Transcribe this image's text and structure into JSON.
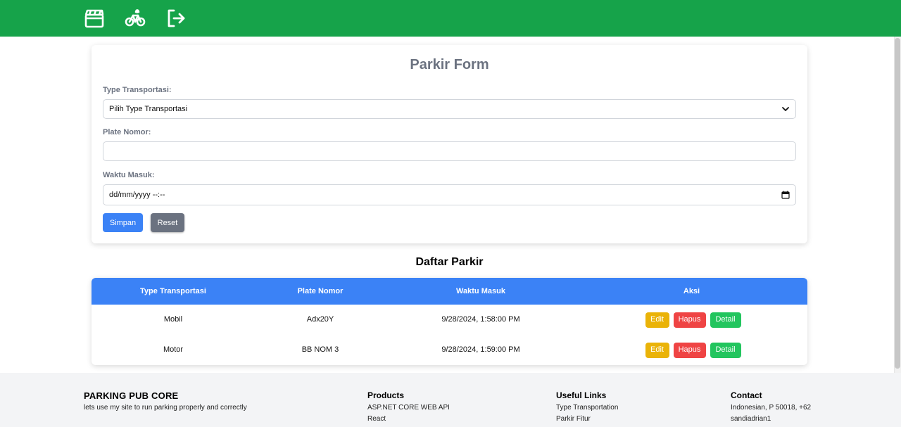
{
  "nav": {
    "icons": [
      "clapperboard-icon",
      "bicycle-icon",
      "logout-icon"
    ]
  },
  "form": {
    "title": "Parkir Form",
    "type_label": "Type Transportasi:",
    "type_selected": "Pilih Type Transportasi",
    "plate_label": "Plate Nomor:",
    "plate_value": "",
    "time_label": "Waktu Masuk:",
    "time_placeholder": "dd/mm/yyyy --:--",
    "save_label": "Simpan",
    "reset_label": "Reset"
  },
  "list": {
    "title": "Daftar Parkir",
    "columns": [
      "Type Transportasi",
      "Plate Nomor",
      "Waktu Masuk",
      "Aksi"
    ],
    "rows": [
      {
        "type": "Mobil",
        "plate": "Adx20Y",
        "time": "9/28/2024, 1:58:00 PM"
      },
      {
        "type": "Motor",
        "plate": "BB NOM 3",
        "time": "9/28/2024, 1:59:00 PM"
      }
    ],
    "actions": {
      "edit": "Edit",
      "hapus": "Hapus",
      "detail": "Detail"
    }
  },
  "footer": {
    "brand": "PARKING PUB CORE",
    "tagline": "lets use my site to run parking properly and correctly",
    "products_title": "Products",
    "products": [
      "ASP.NET CORE WEB API",
      "React"
    ],
    "links_title": "Useful Links",
    "links": [
      "Type Transportation",
      "Parkir Fitur"
    ],
    "contact_title": "Contact",
    "contact": [
      "Indonesian, P 50018, +62",
      "sandiadrian1"
    ]
  },
  "colors": {
    "nav_green": "#16a34a",
    "primary_blue": "#3b82f6",
    "secondary_gray": "#6b7280",
    "edit_yellow": "#eab308",
    "delete_red": "#ef4444",
    "detail_green": "#22c55e"
  }
}
